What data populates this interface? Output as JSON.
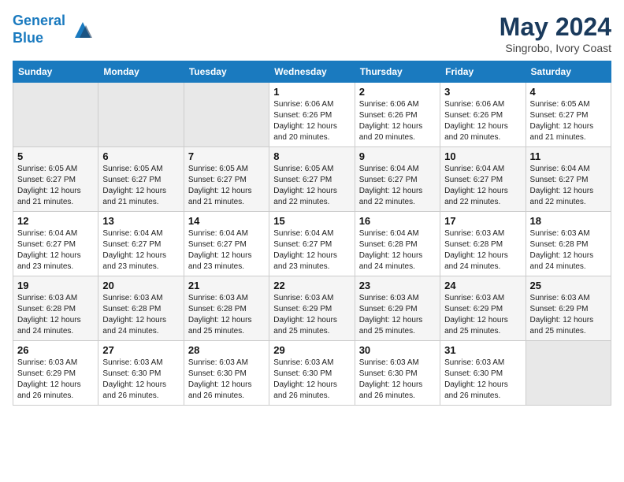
{
  "logo": {
    "line1": "General",
    "line2": "Blue"
  },
  "title": "May 2024",
  "location": "Singrobo, Ivory Coast",
  "weekdays": [
    "Sunday",
    "Monday",
    "Tuesday",
    "Wednesday",
    "Thursday",
    "Friday",
    "Saturday"
  ],
  "weeks": [
    [
      {
        "day": "",
        "info": ""
      },
      {
        "day": "",
        "info": ""
      },
      {
        "day": "",
        "info": ""
      },
      {
        "day": "1",
        "info": "Sunrise: 6:06 AM\nSunset: 6:26 PM\nDaylight: 12 hours\nand 20 minutes."
      },
      {
        "day": "2",
        "info": "Sunrise: 6:06 AM\nSunset: 6:26 PM\nDaylight: 12 hours\nand 20 minutes."
      },
      {
        "day": "3",
        "info": "Sunrise: 6:06 AM\nSunset: 6:26 PM\nDaylight: 12 hours\nand 20 minutes."
      },
      {
        "day": "4",
        "info": "Sunrise: 6:05 AM\nSunset: 6:27 PM\nDaylight: 12 hours\nand 21 minutes."
      }
    ],
    [
      {
        "day": "5",
        "info": "Sunrise: 6:05 AM\nSunset: 6:27 PM\nDaylight: 12 hours\nand 21 minutes."
      },
      {
        "day": "6",
        "info": "Sunrise: 6:05 AM\nSunset: 6:27 PM\nDaylight: 12 hours\nand 21 minutes."
      },
      {
        "day": "7",
        "info": "Sunrise: 6:05 AM\nSunset: 6:27 PM\nDaylight: 12 hours\nand 21 minutes."
      },
      {
        "day": "8",
        "info": "Sunrise: 6:05 AM\nSunset: 6:27 PM\nDaylight: 12 hours\nand 22 minutes."
      },
      {
        "day": "9",
        "info": "Sunrise: 6:04 AM\nSunset: 6:27 PM\nDaylight: 12 hours\nand 22 minutes."
      },
      {
        "day": "10",
        "info": "Sunrise: 6:04 AM\nSunset: 6:27 PM\nDaylight: 12 hours\nand 22 minutes."
      },
      {
        "day": "11",
        "info": "Sunrise: 6:04 AM\nSunset: 6:27 PM\nDaylight: 12 hours\nand 22 minutes."
      }
    ],
    [
      {
        "day": "12",
        "info": "Sunrise: 6:04 AM\nSunset: 6:27 PM\nDaylight: 12 hours\nand 23 minutes."
      },
      {
        "day": "13",
        "info": "Sunrise: 6:04 AM\nSunset: 6:27 PM\nDaylight: 12 hours\nand 23 minutes."
      },
      {
        "day": "14",
        "info": "Sunrise: 6:04 AM\nSunset: 6:27 PM\nDaylight: 12 hours\nand 23 minutes."
      },
      {
        "day": "15",
        "info": "Sunrise: 6:04 AM\nSunset: 6:27 PM\nDaylight: 12 hours\nand 23 minutes."
      },
      {
        "day": "16",
        "info": "Sunrise: 6:04 AM\nSunset: 6:28 PM\nDaylight: 12 hours\nand 24 minutes."
      },
      {
        "day": "17",
        "info": "Sunrise: 6:03 AM\nSunset: 6:28 PM\nDaylight: 12 hours\nand 24 minutes."
      },
      {
        "day": "18",
        "info": "Sunrise: 6:03 AM\nSunset: 6:28 PM\nDaylight: 12 hours\nand 24 minutes."
      }
    ],
    [
      {
        "day": "19",
        "info": "Sunrise: 6:03 AM\nSunset: 6:28 PM\nDaylight: 12 hours\nand 24 minutes."
      },
      {
        "day": "20",
        "info": "Sunrise: 6:03 AM\nSunset: 6:28 PM\nDaylight: 12 hours\nand 24 minutes."
      },
      {
        "day": "21",
        "info": "Sunrise: 6:03 AM\nSunset: 6:28 PM\nDaylight: 12 hours\nand 25 minutes."
      },
      {
        "day": "22",
        "info": "Sunrise: 6:03 AM\nSunset: 6:29 PM\nDaylight: 12 hours\nand 25 minutes."
      },
      {
        "day": "23",
        "info": "Sunrise: 6:03 AM\nSunset: 6:29 PM\nDaylight: 12 hours\nand 25 minutes."
      },
      {
        "day": "24",
        "info": "Sunrise: 6:03 AM\nSunset: 6:29 PM\nDaylight: 12 hours\nand 25 minutes."
      },
      {
        "day": "25",
        "info": "Sunrise: 6:03 AM\nSunset: 6:29 PM\nDaylight: 12 hours\nand 25 minutes."
      }
    ],
    [
      {
        "day": "26",
        "info": "Sunrise: 6:03 AM\nSunset: 6:29 PM\nDaylight: 12 hours\nand 26 minutes."
      },
      {
        "day": "27",
        "info": "Sunrise: 6:03 AM\nSunset: 6:30 PM\nDaylight: 12 hours\nand 26 minutes."
      },
      {
        "day": "28",
        "info": "Sunrise: 6:03 AM\nSunset: 6:30 PM\nDaylight: 12 hours\nand 26 minutes."
      },
      {
        "day": "29",
        "info": "Sunrise: 6:03 AM\nSunset: 6:30 PM\nDaylight: 12 hours\nand 26 minutes."
      },
      {
        "day": "30",
        "info": "Sunrise: 6:03 AM\nSunset: 6:30 PM\nDaylight: 12 hours\nand 26 minutes."
      },
      {
        "day": "31",
        "info": "Sunrise: 6:03 AM\nSunset: 6:30 PM\nDaylight: 12 hours\nand 26 minutes."
      },
      {
        "day": "",
        "info": ""
      }
    ]
  ]
}
